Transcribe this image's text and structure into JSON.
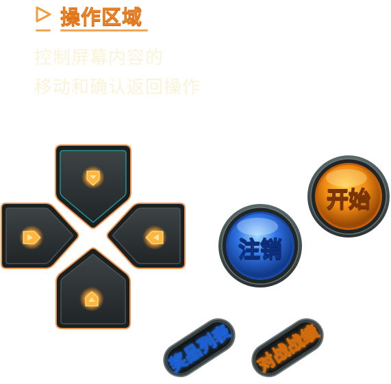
{
  "header": {
    "title": "操作区域",
    "arrow_icon": "play-triangle-icon",
    "accent_color": "#f39a3e"
  },
  "description": {
    "line1": "控制屏幕内容的",
    "line2": "移动和确认返回操作"
  },
  "dpad": {
    "up_icon": "chevron-down-icon",
    "left_icon": "chevron-right-icon",
    "right_icon": "chevron-left-icon",
    "down_icon": "chevron-up-icon",
    "glow_color": "#ff9a2a",
    "body_color": "#2f3436"
  },
  "buttons": {
    "start_label": "开始",
    "start_color": "#f08a12",
    "logout_label": "注销",
    "logout_color": "#2f74e6",
    "prizes_label": "奖品列表",
    "prizes_color": "#3d8cff",
    "battle_label": "对战战绩",
    "battle_color": "#ff9a2a"
  }
}
